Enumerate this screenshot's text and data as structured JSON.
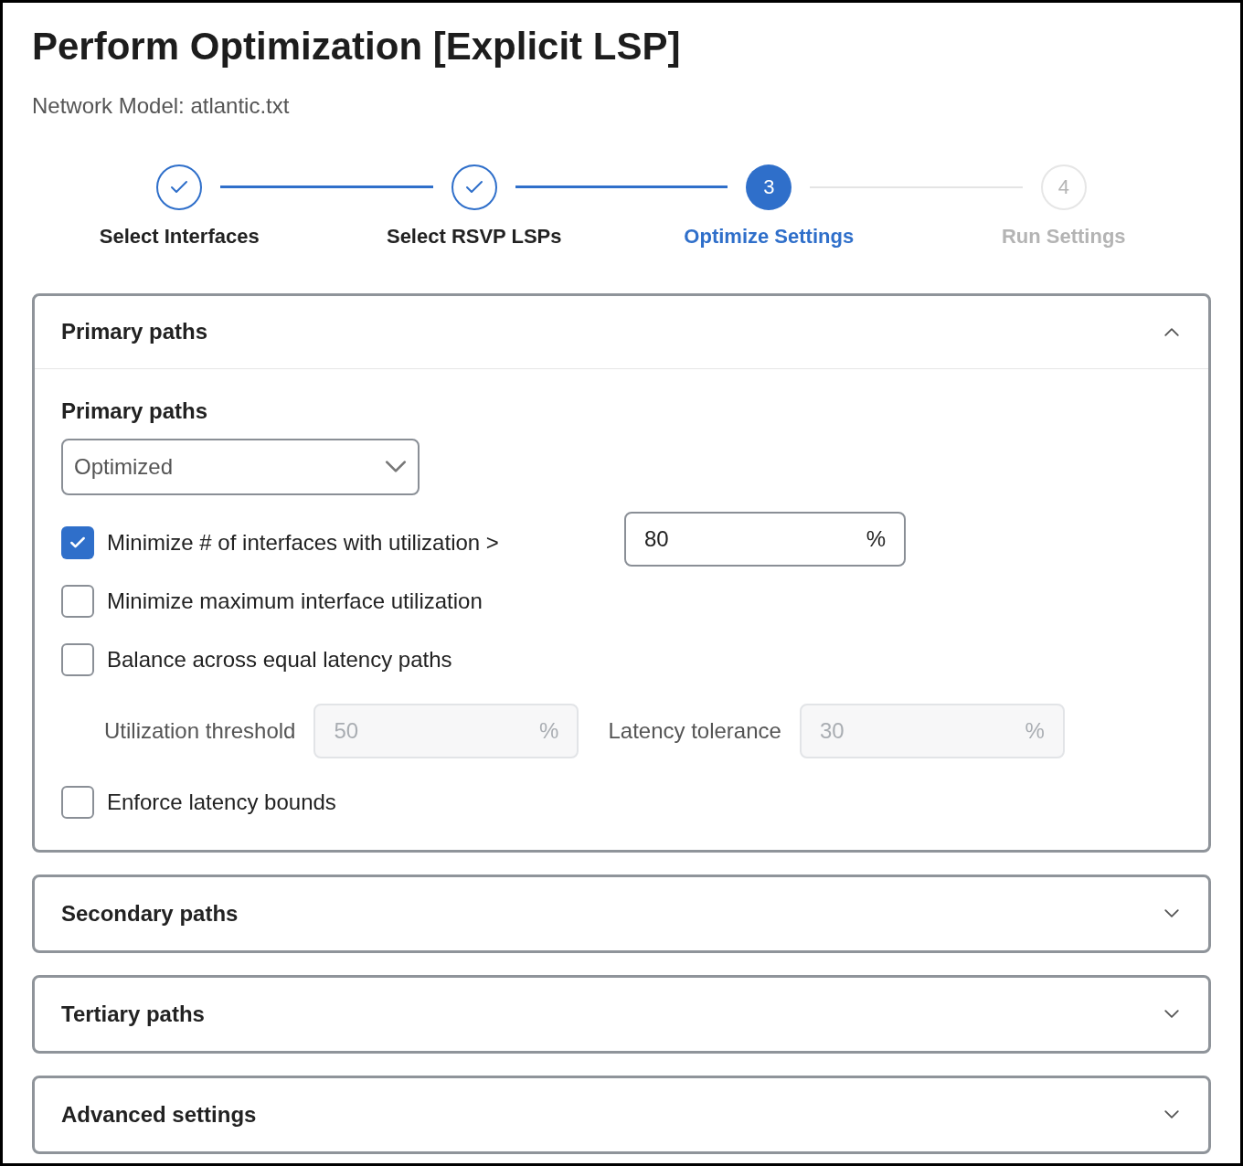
{
  "title": "Perform Optimization [Explicit LSP]",
  "subtitle": "Network Model: atlantic.txt",
  "steps": [
    {
      "label": "Select Interfaces",
      "completed": true,
      "selected": false
    },
    {
      "label": "Select RSVP LSPs",
      "completed": true,
      "selected": false
    },
    {
      "number": "3",
      "label": "Optimize Settings",
      "completed": false,
      "selected": true
    },
    {
      "number": "4",
      "label": "Run Settings",
      "completed": false,
      "selected": false
    }
  ],
  "sections": [
    {
      "title": "Primary paths",
      "expanded": true,
      "content": {
        "select_label": "Primary paths",
        "select_value": "Optimized",
        "options": [
          {
            "label": "Minimize # of interfaces with utilization >",
            "checked": true,
            "field": {
              "value": "80",
              "unit": "%",
              "disabled": false
            }
          },
          {
            "label": "Minimize maximum interface utilization",
            "checked": false
          },
          {
            "label": "Balance across equal latency paths",
            "checked": false,
            "sub_fields": [
              {
                "label": "Utilization threshold",
                "value": "50",
                "unit": "%",
                "disabled": true
              },
              {
                "label": "Latency tolerance",
                "value": "30",
                "unit": "%",
                "disabled": true
              }
            ]
          },
          {
            "label": "Enforce latency bounds",
            "checked": false
          }
        ]
      }
    },
    {
      "title": "Secondary paths",
      "expanded": false
    },
    {
      "title": "Tertiary paths",
      "expanded": false
    },
    {
      "title": "Advanced settings",
      "expanded": false
    }
  ]
}
